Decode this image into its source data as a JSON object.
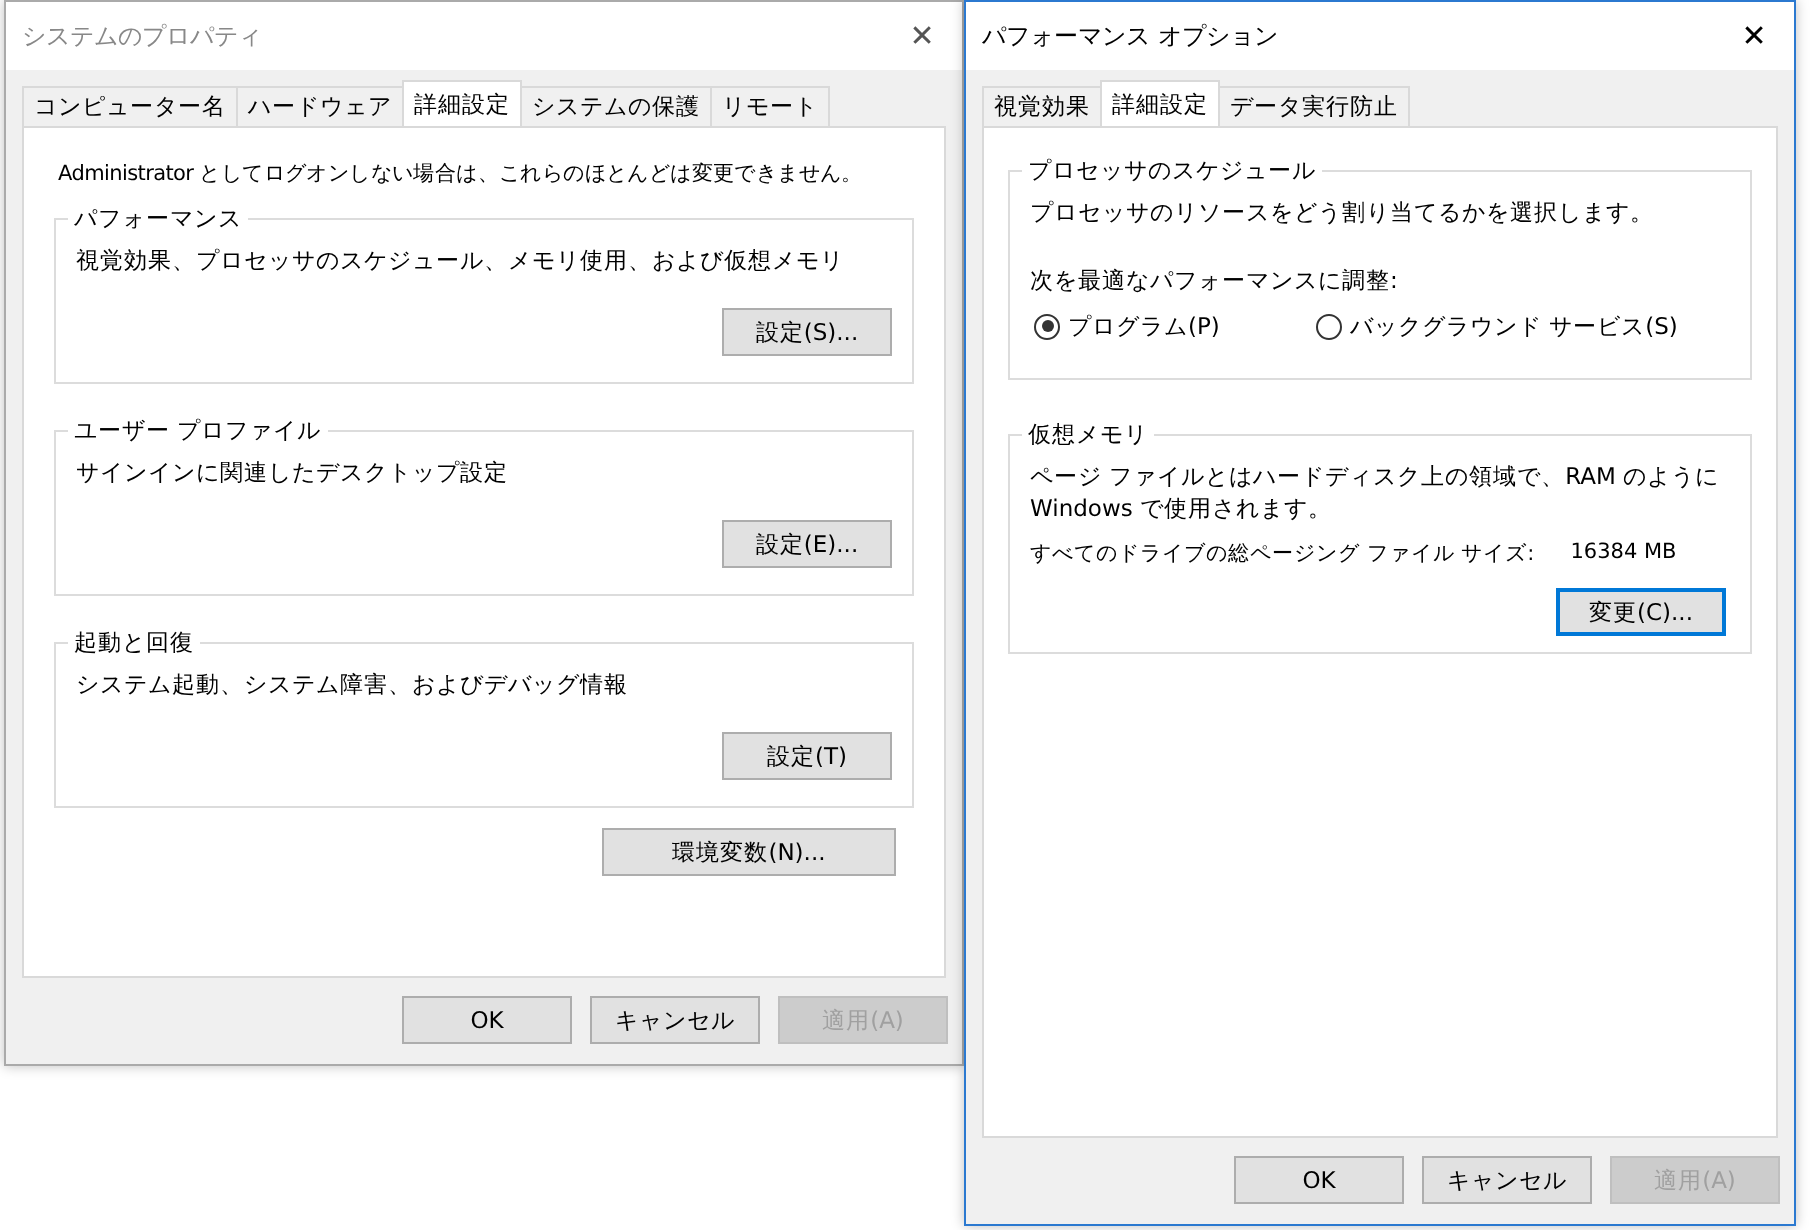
{
  "windows": [
    {
      "kind": "system",
      "title": "システムのプロパティ",
      "active": false,
      "close": "✕",
      "tabs": [
        {
          "label": "コンピューター名",
          "selected": false
        },
        {
          "label": "ハードウェア",
          "selected": false
        },
        {
          "label": "詳細設定",
          "selected": true
        },
        {
          "label": "システムの保護",
          "selected": false
        },
        {
          "label": "リモート",
          "selected": false
        }
      ],
      "notice": "Administrator としてログオンしない場合は、これらのほとんどは変更できません。",
      "groups": [
        {
          "title": "パフォーマンス",
          "description": "視覚効果、プロセッサのスケジュール、メモリ使用、および仮想メモリ",
          "button": "設定(S)..."
        },
        {
          "title": "ユーザー プロファイル",
          "description": "サインインに関連したデスクトップ設定",
          "button": "設定(E)..."
        },
        {
          "title": "起動と回復",
          "description": "システム起動、システム障害、およびデバッグ情報",
          "button": "設定(T)"
        }
      ],
      "env_button": "環境変数(N)...",
      "buttons": [
        {
          "label": "OK",
          "disabled": false
        },
        {
          "label": "キャンセル",
          "disabled": false
        },
        {
          "label": "適用(A)",
          "disabled": true
        }
      ]
    },
    {
      "kind": "performance",
      "title": "パフォーマンス オプション",
      "active": true,
      "close": "✕",
      "tabs": [
        {
          "label": "視覚効果",
          "selected": false
        },
        {
          "label": "詳細設定",
          "selected": true
        },
        {
          "label": "データ実行防止",
          "selected": false
        }
      ],
      "processor": {
        "title": "プロセッサのスケジュール",
        "description": "プロセッサのリソースをどう割り当てるかを選択します。",
        "adjust_label": "次を最適なパフォーマンスに調整:",
        "options": [
          {
            "label": "プログラム(P)",
            "selected": true
          },
          {
            "label": "バックグラウンド サービス(S)",
            "selected": false
          }
        ]
      },
      "memory": {
        "title": "仮想メモリ",
        "description": "ページ ファイルとはハードディスク上の領域で、RAM のように Windows で使用されます。",
        "size_label": "すべてのドライブの総ページング ファイル サイズ:",
        "size_value": "16384 MB",
        "button": {
          "label": "変更(C)...",
          "focused": true
        }
      },
      "buttons": [
        {
          "label": "OK",
          "disabled": false
        },
        {
          "label": "キャンセル",
          "disabled": false
        },
        {
          "label": "適用(A)",
          "disabled": true
        }
      ]
    }
  ]
}
